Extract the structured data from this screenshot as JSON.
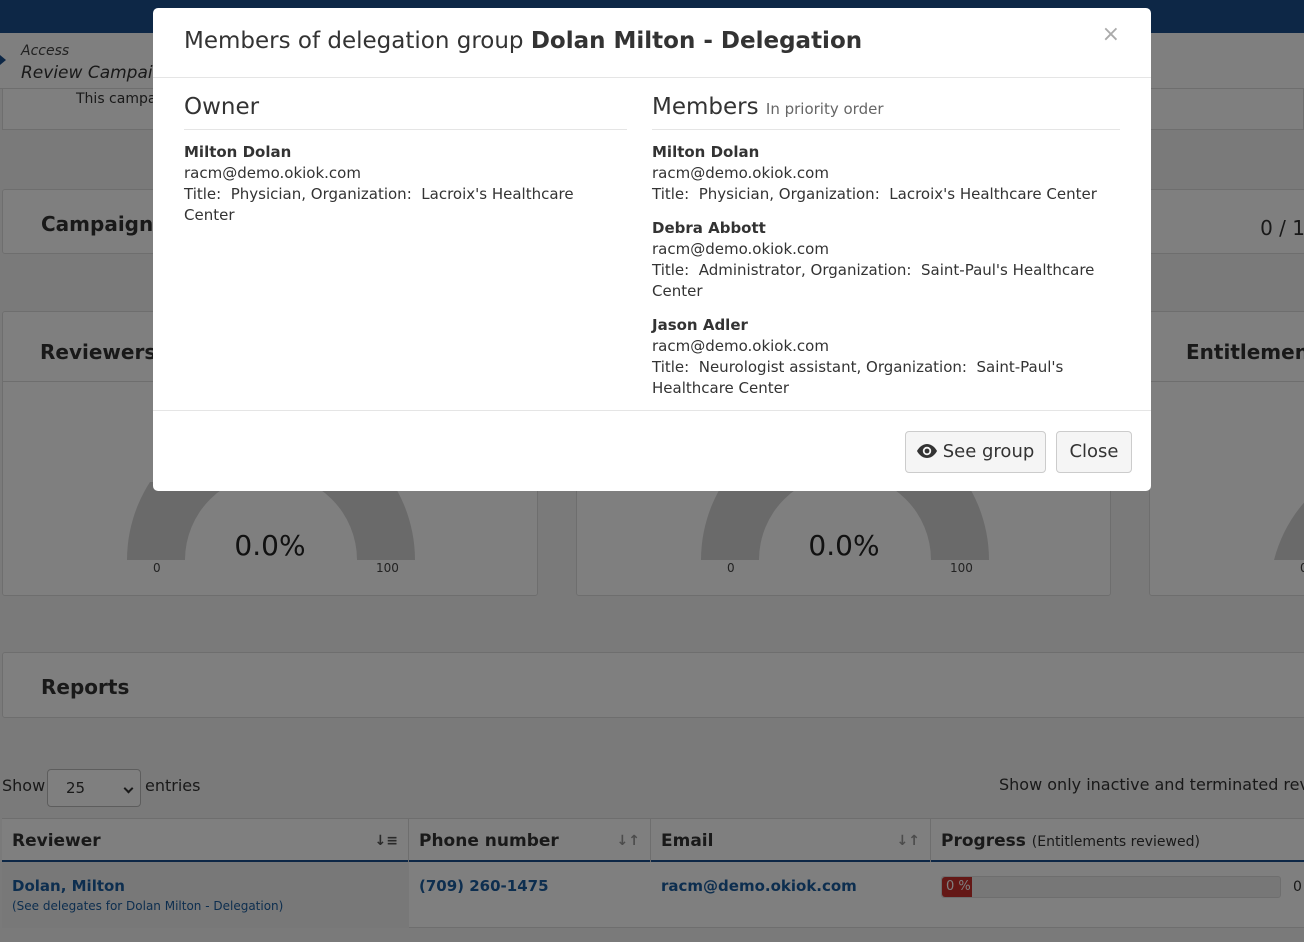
{
  "background": {
    "breadcrumb": {
      "section": "Access",
      "title": "Review Campaign"
    },
    "description": "This campaign",
    "campaign_panel": {
      "title": "Campaign",
      "count": "0 / 1"
    },
    "gauges": [
      {
        "title": "Reviewers d",
        "value": "0.0%",
        "min": "0",
        "max": "100",
        "level": 0
      },
      {
        "title": "",
        "value": "0.0%",
        "min": "0",
        "max": "100",
        "level": 0
      },
      {
        "title": "Entitlements",
        "value": "",
        "min": "0",
        "max": "",
        "level": 0
      }
    ],
    "reports_panel": {
      "title": "Reports"
    },
    "table_controls": {
      "show": "Show",
      "entries_value": "25",
      "entries": "entries",
      "filter_text": "Show only inactive and terminated reviewers"
    },
    "table": {
      "headers": {
        "reviewer": "Reviewer",
        "phone": "Phone number",
        "email": "Email",
        "progress": "Progress",
        "progress_sub": "(Entitlements reviewed)"
      },
      "row": {
        "reviewer": "Dolan, Milton",
        "delegates_link": "(See delegates for Dolan Milton - Delegation)",
        "phone": "(709) 260-1475",
        "email": "racm@demo.okiok.com",
        "progress_label": "0 %",
        "progress_percent": 0,
        "count": "0"
      }
    }
  },
  "modal": {
    "title_prefix": "Members of delegation group",
    "title_group": "Dolan Milton - Delegation",
    "close_symbol": "×",
    "owner": {
      "heading": "Owner",
      "person": {
        "name": "Milton Dolan",
        "email": "racm@demo.okiok.com",
        "details": "Title:  Physician, Organization:  Lacroix's Healthcare Center"
      }
    },
    "members": {
      "heading": "Members",
      "hint": "In priority order",
      "people": [
        {
          "name": "Milton Dolan",
          "email": "racm@demo.okiok.com",
          "details": "Title:  Physician, Organization:  Lacroix's Healthcare Center"
        },
        {
          "name": "Debra Abbott",
          "email": "racm@demo.okiok.com",
          "details": "Title:  Administrator, Organization:  Saint-Paul's Healthcare Center"
        },
        {
          "name": "Jason Adler",
          "email": "racm@demo.okiok.com",
          "details": "Title:  Neurologist assistant, Organization:  Saint-Paul's Healthcare Center"
        }
      ]
    },
    "buttons": {
      "see_group": "See group",
      "close": "Close"
    }
  }
}
